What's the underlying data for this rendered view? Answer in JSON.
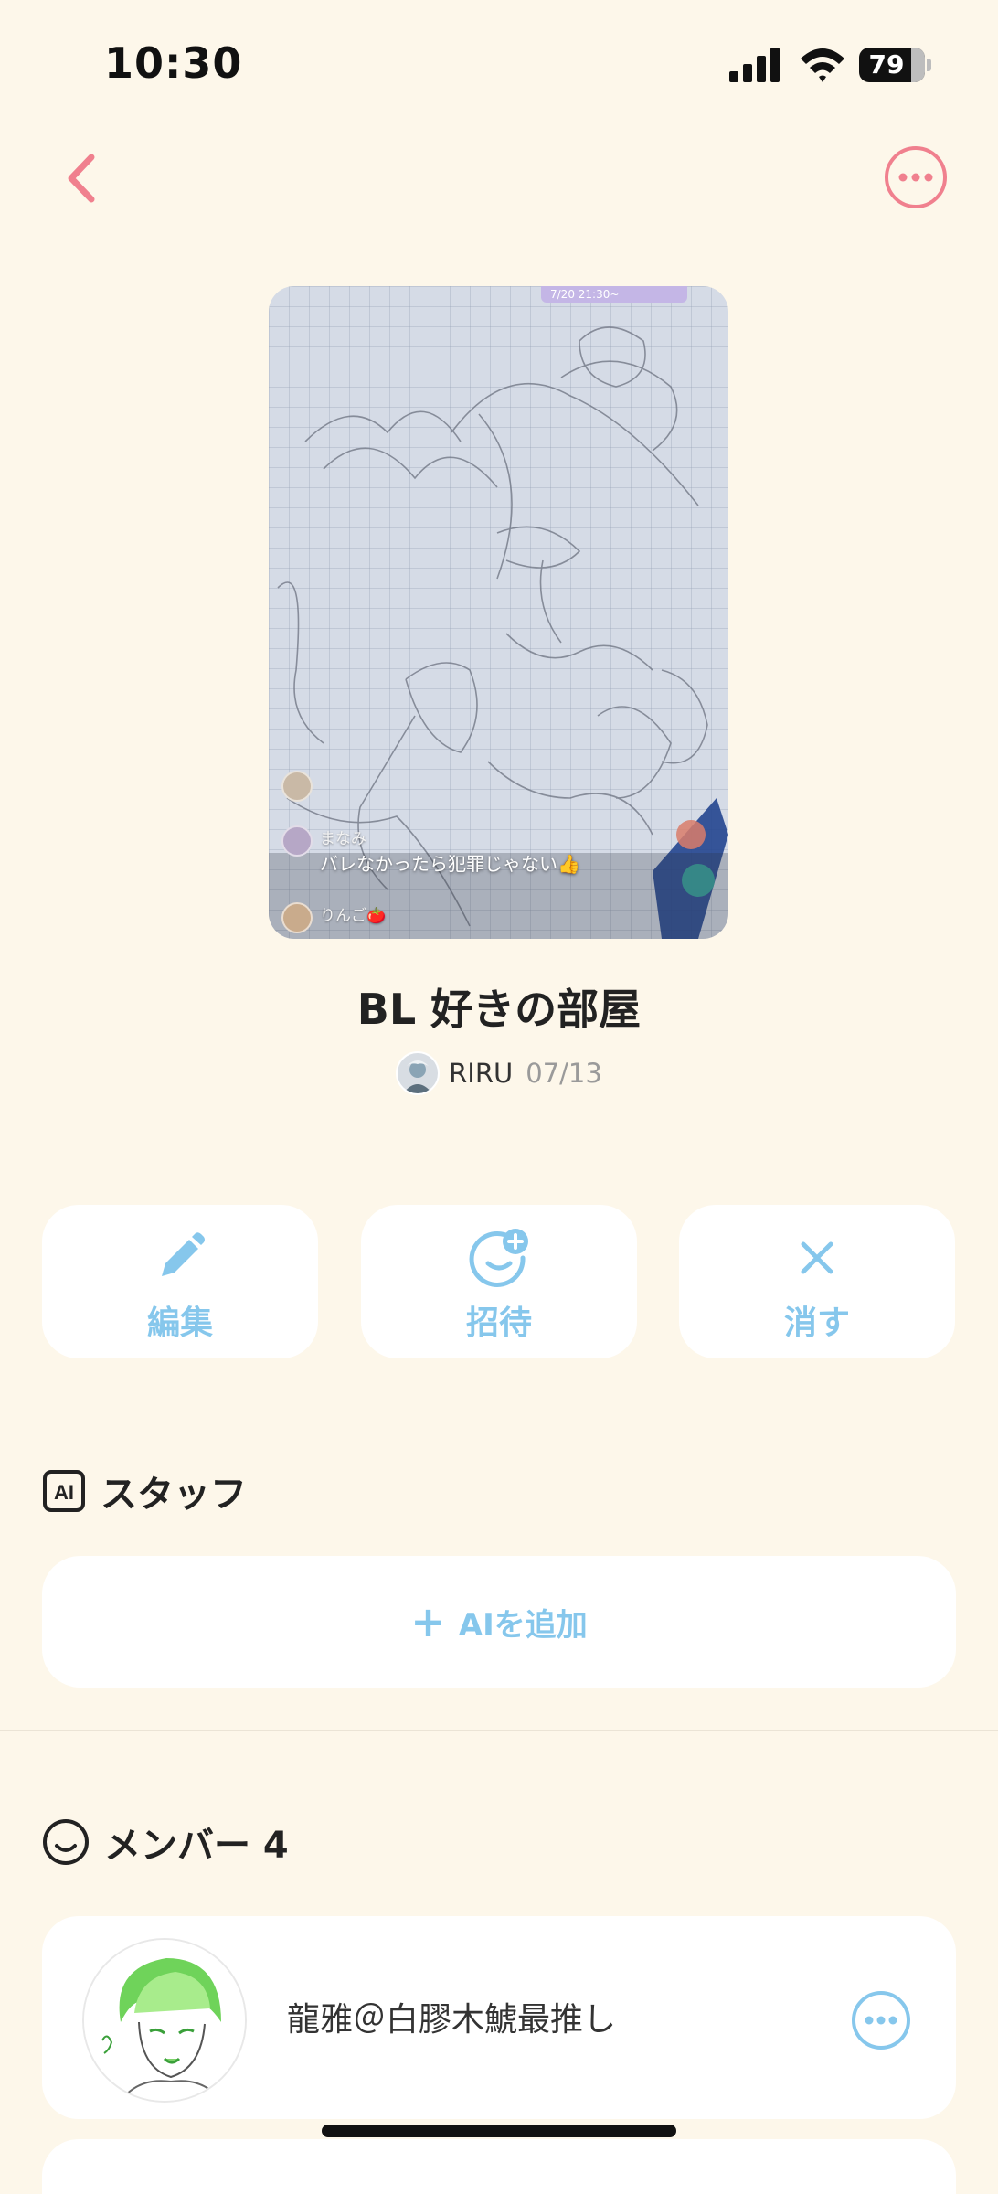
{
  "status_bar": {
    "time": "10:30",
    "battery": "79",
    "battery_level": 0.79
  },
  "nav": {
    "back_icon": "chevron-left-icon",
    "more_icon": "more-horizontal-icon"
  },
  "cover": {
    "stamp": "7/20 21:30~",
    "chat": [
      {
        "name": "まなみ",
        "message": "バレなかったら犯罪じゃない👍"
      },
      {
        "name": "りんご🍅",
        "message": ""
      }
    ]
  },
  "room": {
    "title": "BL 好きの部屋",
    "creator": "RIRU",
    "date": "07/13"
  },
  "actions": {
    "edit": "編集",
    "invite": "招待",
    "delete": "消す"
  },
  "staff": {
    "title": "スタッフ",
    "icon_text": "AI",
    "add_label": "AIを追加"
  },
  "members": {
    "title": "メンバー 4",
    "items": [
      {
        "name": "龍雅＠白膠木鯱最推し"
      }
    ]
  },
  "colors": {
    "background": "#FDF7EA",
    "accent_blue": "#86C7EC",
    "accent_pink": "#F0808E",
    "card": "#FFFFFF"
  }
}
